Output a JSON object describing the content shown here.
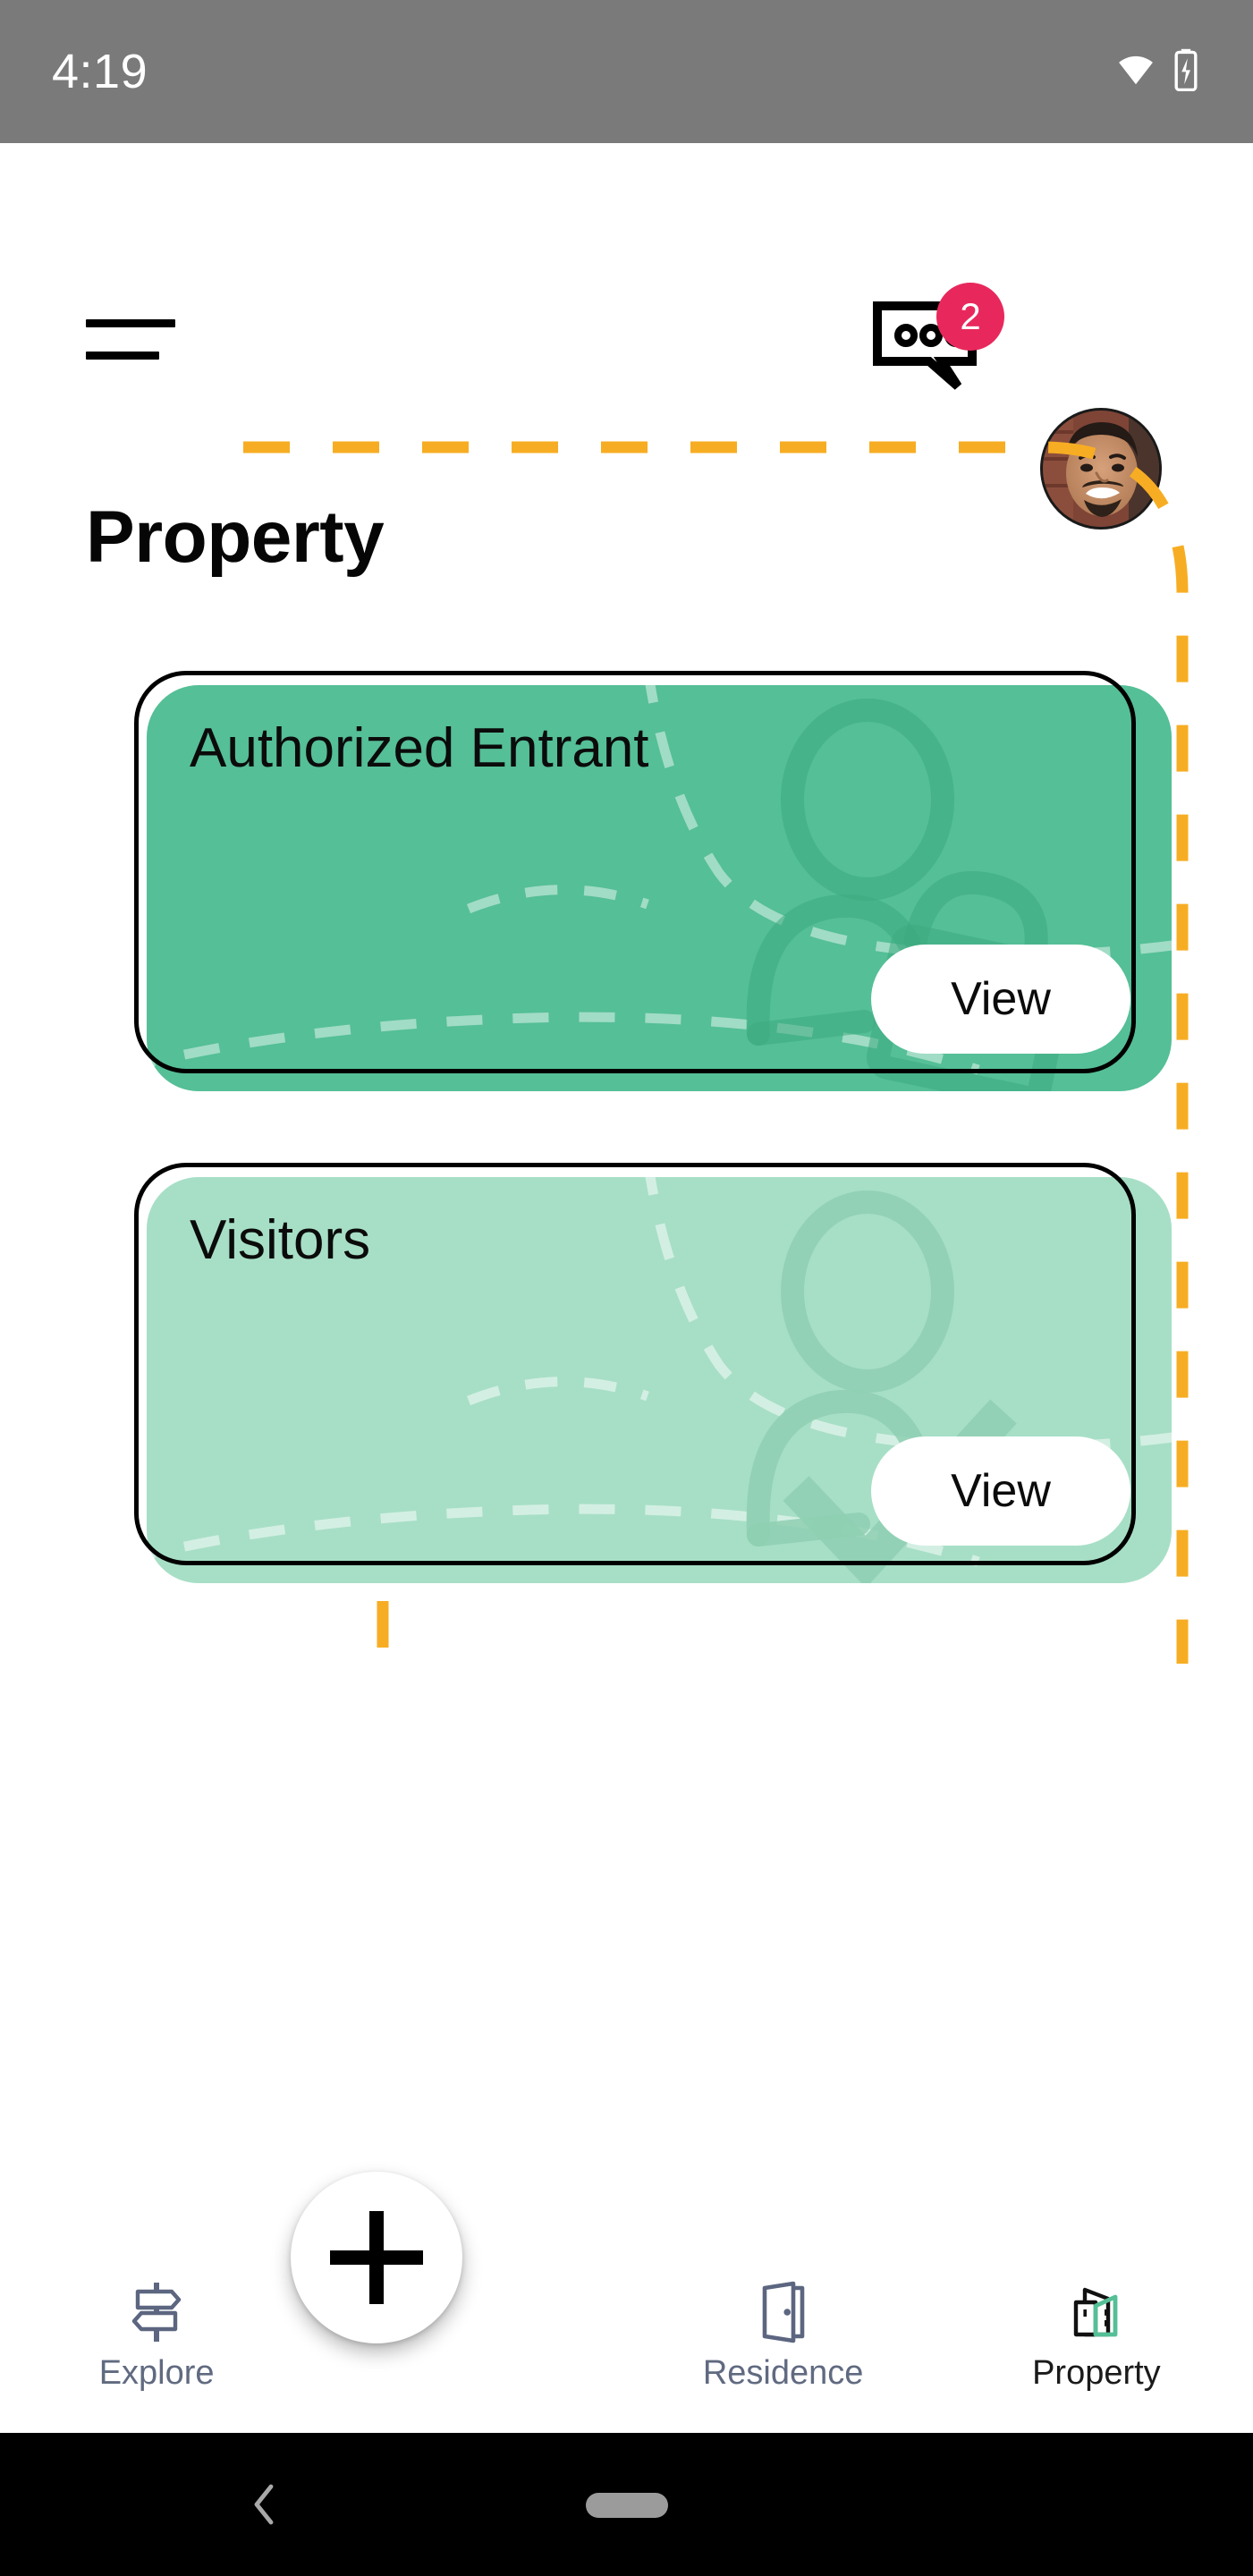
{
  "status_bar": {
    "time": "4:19",
    "wifi_icon": "wifi-icon",
    "battery_icon": "battery-charging-icon",
    "background_color": "#7a7a7a"
  },
  "header": {
    "menu_icon": "hamburger-menu-icon",
    "chat_icon": "chat-bubble-icon",
    "chat_badge_count": "2",
    "chat_badge_color": "#e8285c",
    "avatar_icon": "user-avatar"
  },
  "page": {
    "title": "Property",
    "accent_dashed_color": "#f7ad23"
  },
  "cards": [
    {
      "title": "Authorized Entrant",
      "button_label": "View",
      "background_color": "#55bf97",
      "watermark_icon": "person-unlock-icon"
    },
    {
      "title": "Visitors",
      "button_label": "View",
      "background_color": "#a7dfc6",
      "watermark_icon": "person-check-icon"
    }
  ],
  "fab": {
    "icon": "plus-icon",
    "label": ""
  },
  "bottom_nav": {
    "items": [
      {
        "label": "Explore",
        "icon": "signpost-icon",
        "active": false
      },
      {
        "label": "Residence",
        "icon": "open-door-icon",
        "active": false
      },
      {
        "label": "Property",
        "icon": "buildings-icon",
        "active": true
      }
    ],
    "active_accent_color": "#55bf97",
    "inactive_color": "#606a80"
  },
  "android_nav": {
    "back_icon": "back-chevron-icon",
    "home_icon": "home-pill-icon"
  }
}
